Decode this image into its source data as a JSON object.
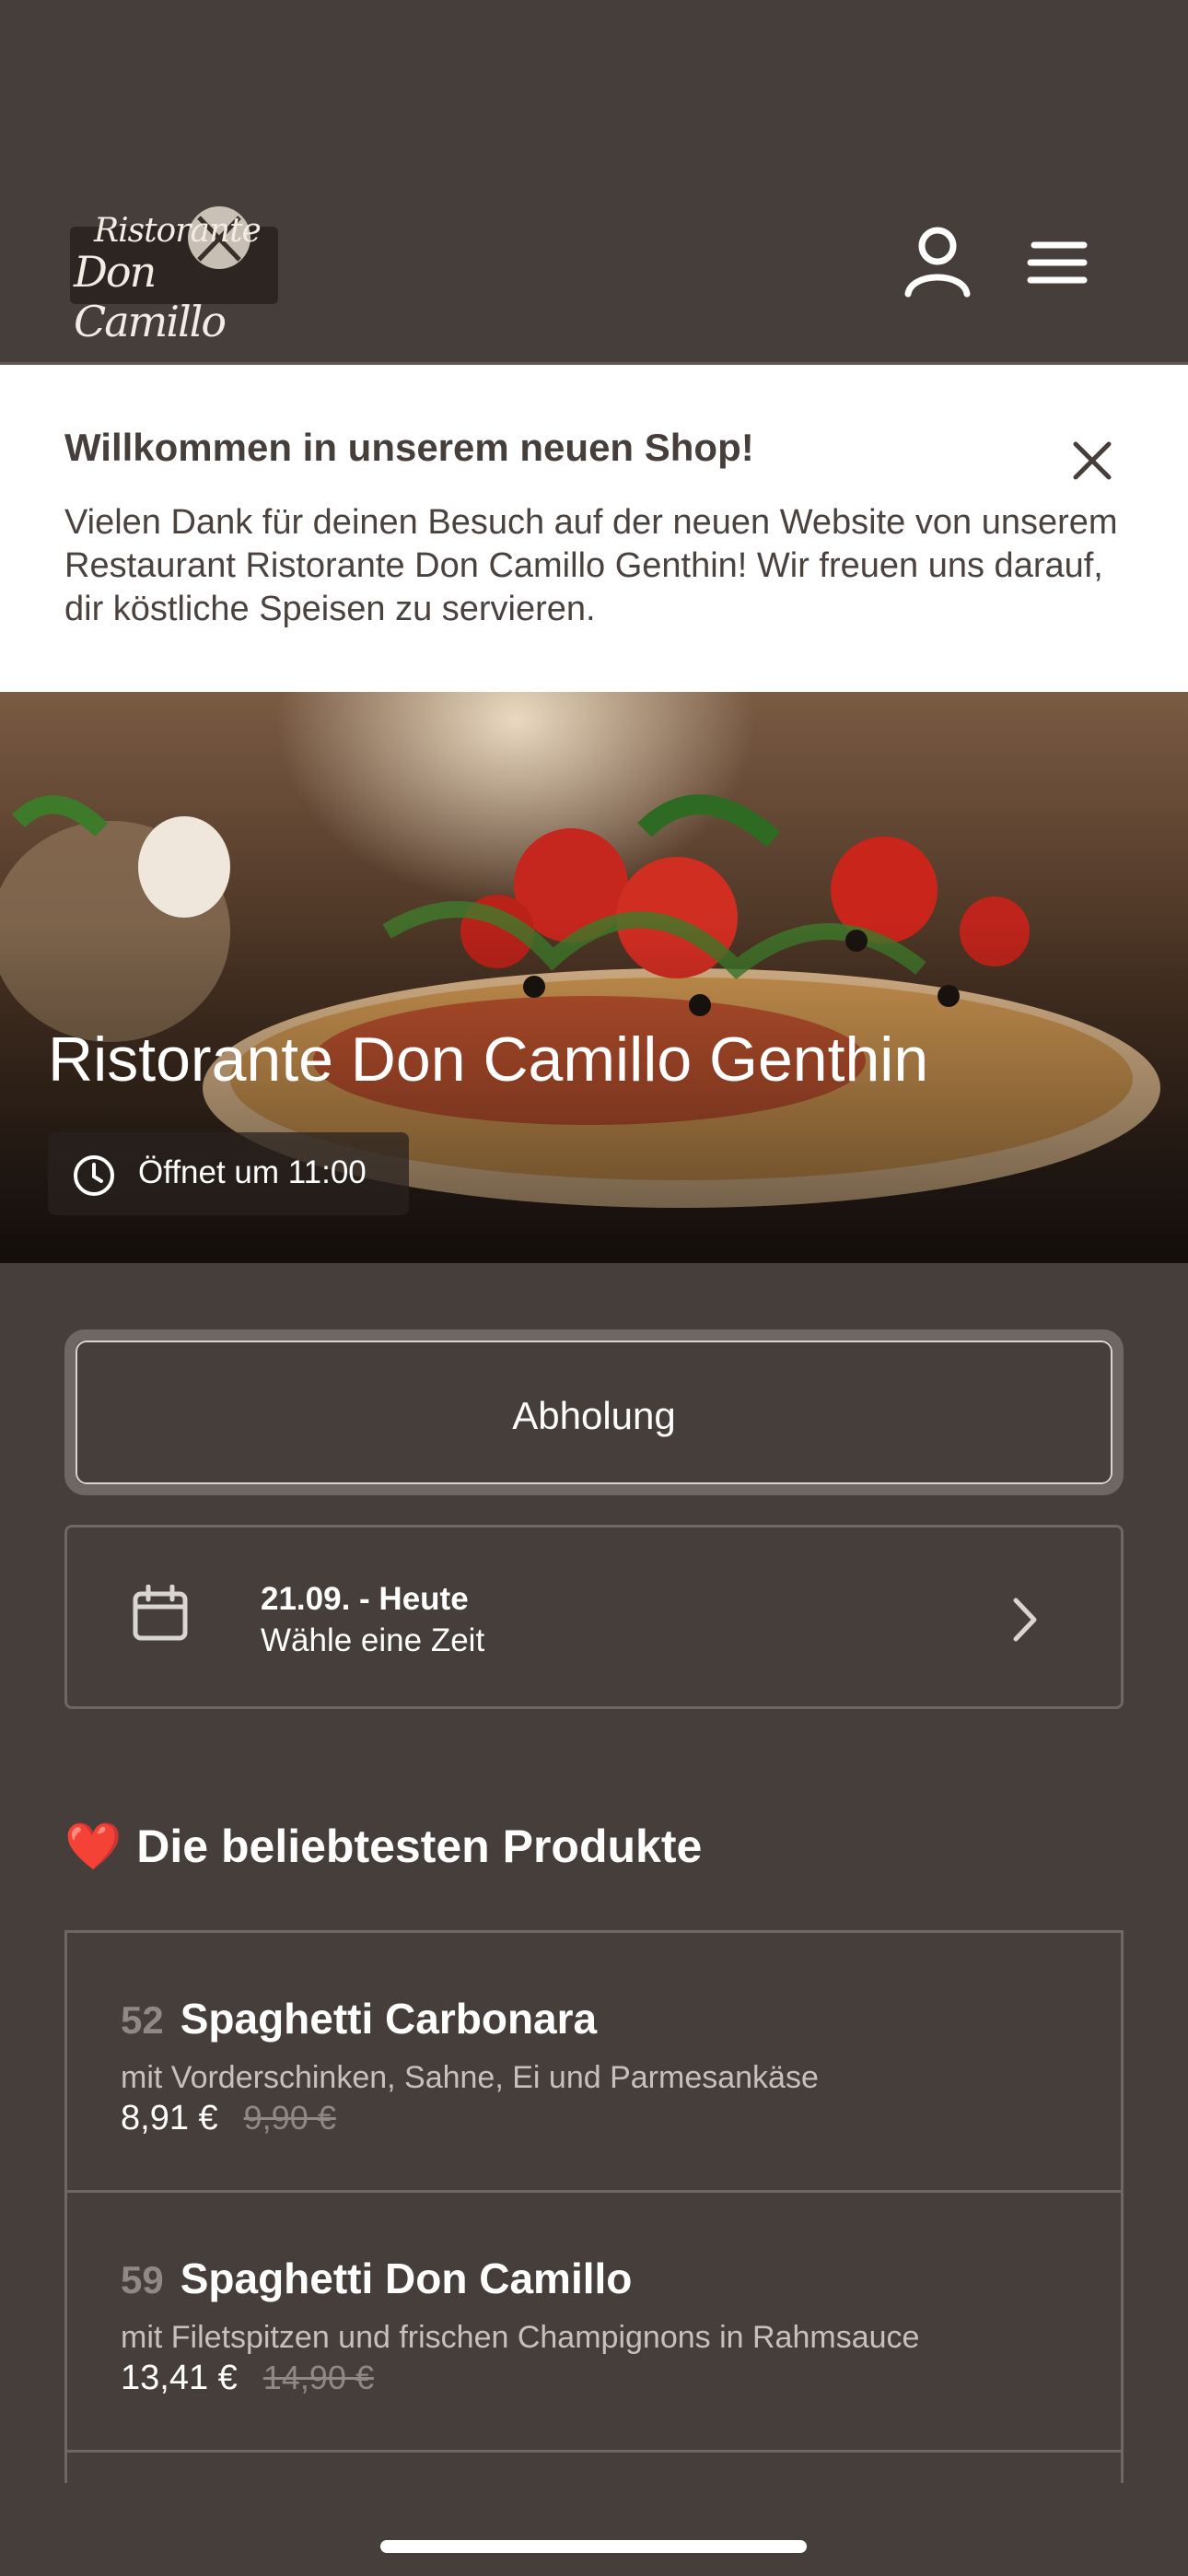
{
  "header": {
    "logo_line1": "Ristorante",
    "logo_line2": "Don Camillo",
    "user_icon": "user-icon",
    "menu_icon": "hamburger-menu-icon"
  },
  "welcome": {
    "title": "Willkommen in unserem neuen Shop!",
    "text": "Vielen Dank für deinen Besuch auf der neuen Website von unserem Restaurant Ristorante Don Camillo Genthin! Wir freuen uns darauf, dir köstliche Speisen zu servieren.",
    "close_icon": "close-icon"
  },
  "hero": {
    "title": "Ristorante Don Camillo Genthin",
    "hours": "Öffnet um 11:00",
    "hours_icon": "clock-icon"
  },
  "order": {
    "pickup_label": "Abholung",
    "date_title": "21.09. - Heute",
    "date_sub": "Wähle eine Zeit",
    "calendar_icon": "calendar-icon",
    "chevron_icon": "chevron-right-icon"
  },
  "popular": {
    "title": "Die beliebtesten Produkte",
    "heart": "❤️",
    "products": [
      {
        "number": "52",
        "name": "Spaghetti Carbonara",
        "description": "mit Vorderschinken, Sahne, Ei und Parmesankäse",
        "price": "8,91 €",
        "old_price": "9,90 €"
      },
      {
        "number": "59",
        "name": "Spaghetti Don Camillo",
        "description": "mit Filetspitzen und frischen Champignons in Rahmsauce",
        "price": "13,41 €",
        "old_price": "14,90 €"
      }
    ]
  },
  "colors": {
    "background": "#463e3b",
    "panel_border": "#6f6764",
    "white": "#ffffff",
    "heart_red": "#d42a2a"
  }
}
